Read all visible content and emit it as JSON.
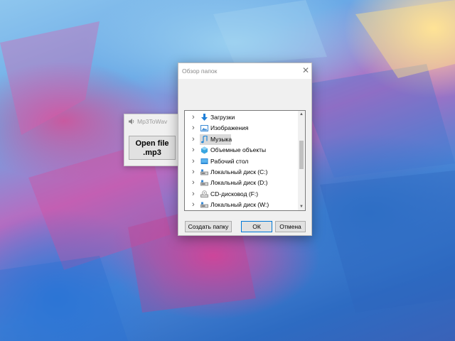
{
  "app_window": {
    "title": "Mp3ToWav",
    "icon": "speaker-icon",
    "open_button": {
      "line1": "Open file",
      "line2": ".mp3"
    }
  },
  "dialog": {
    "title": "Обзор папок",
    "close_icon": "close-icon",
    "tree": [
      {
        "label": "Загрузки",
        "icon": "downloads-icon",
        "selected": false
      },
      {
        "label": "Изображения",
        "icon": "pictures-icon",
        "selected": false
      },
      {
        "label": "Музыка",
        "icon": "music-icon",
        "selected": true
      },
      {
        "label": "Объемные объекты",
        "icon": "3d-objects-icon",
        "selected": false
      },
      {
        "label": "Рабочий стол",
        "icon": "desktop-icon",
        "selected": false
      },
      {
        "label": "Локальный диск (C:)",
        "icon": "drive-icon",
        "selected": false
      },
      {
        "label": "Локальный диск (D:)",
        "icon": "drive-icon",
        "selected": false
      },
      {
        "label": "CD-дисковод (F:)",
        "icon": "cd-drive-icon",
        "selected": false
      },
      {
        "label": "Локальный диск (W:)",
        "icon": "drive-icon",
        "selected": false
      }
    ],
    "buttons": {
      "new_folder": "Создать папку",
      "ok": "ОК",
      "cancel": "Отмена"
    }
  }
}
